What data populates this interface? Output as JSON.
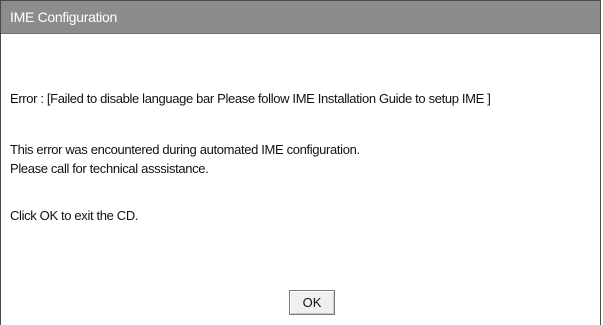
{
  "window": {
    "title": "IME Configuration"
  },
  "message": {
    "error_line": "Error : [Failed to disable language bar Please follow IME Installation Guide to setup IME ]",
    "encountered_line": "This error was encountered during automated IME configuration.",
    "assistance_line": "Please call for technical asssistance.",
    "instruction_line": "Click OK to exit the CD."
  },
  "buttons": {
    "ok_label": "OK"
  },
  "colors": {
    "titlebar": "#8c8c8c",
    "title_text": "#ffffff",
    "body_text": "#111111",
    "background": "#ffffff"
  }
}
